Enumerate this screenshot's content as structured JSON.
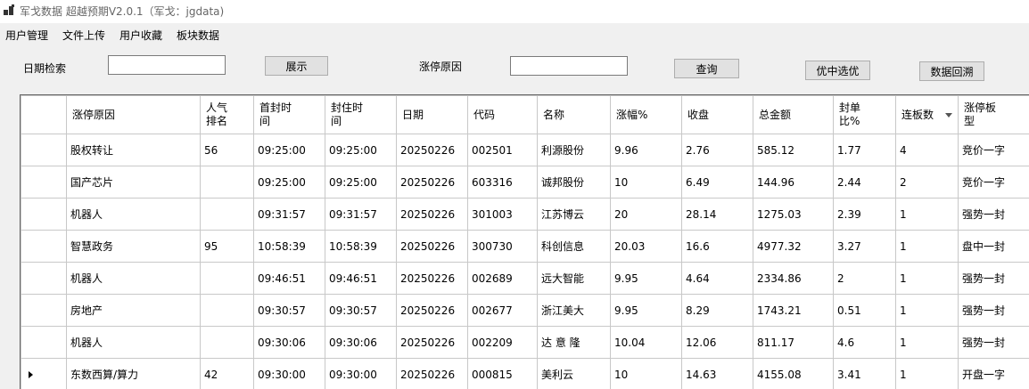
{
  "window": {
    "title": "军戈数据 超越预期V2.0.1（军戈：jgdata)"
  },
  "menu": [
    "用户管理",
    "文件上传",
    "用户收藏",
    "板块数据"
  ],
  "toolbar": {
    "date_label": "日期检索",
    "date_value": "",
    "show_button": "展示",
    "reason_label": "涨停原因",
    "reason_value": "",
    "query_button": "查询",
    "select_button": "优中选优",
    "backtest_button": "数据回溯"
  },
  "grid": {
    "columns": [
      "涨停原因",
      "人气排名",
      "首封时间",
      "封住时间",
      "日期",
      "代码",
      "名称",
      "涨幅%",
      "收盘",
      "总金额",
      "封单比%",
      "连板数",
      "涨停板型"
    ],
    "header_lines": [
      [
        "涨停原因"
      ],
      [
        "人气",
        "排名"
      ],
      [
        "首封时",
        "间"
      ],
      [
        "封住时",
        "间"
      ],
      [
        "日期"
      ],
      [
        "代码"
      ],
      [
        "名称"
      ],
      [
        "涨幅%"
      ],
      [
        "收盘"
      ],
      [
        "总金额"
      ],
      [
        "封单",
        "比%"
      ],
      [
        "连板数"
      ],
      [
        "涨停板",
        "型"
      ]
    ],
    "sorted_column": "连板数",
    "current_row": 7,
    "rows": [
      [
        "股权转让",
        "56",
        "09:25:00",
        "09:25:00",
        "20250226",
        "002501",
        "利源股份",
        "9.96",
        "2.76",
        "585.12",
        "1.77",
        "4",
        "竞价一字"
      ],
      [
        "国产芯片",
        "",
        "09:25:00",
        "09:25:00",
        "20250226",
        "603316",
        "诚邦股份",
        "10",
        "6.49",
        "144.96",
        "2.44",
        "2",
        "竞价一字"
      ],
      [
        "机器人",
        "",
        "09:31:57",
        "09:31:57",
        "20250226",
        "301003",
        "江苏博云",
        "20",
        "28.14",
        "1275.03",
        "2.39",
        "1",
        "强势一封"
      ],
      [
        "智慧政务",
        "95",
        "10:58:39",
        "10:58:39",
        "20250226",
        "300730",
        "科创信息",
        "20.03",
        "16.6",
        "4977.32",
        "3.27",
        "1",
        "盘中一封"
      ],
      [
        "机器人",
        "",
        "09:46:51",
        "09:46:51",
        "20250226",
        "002689",
        "远大智能",
        "9.95",
        "4.64",
        "2334.86",
        "2",
        "1",
        "强势一封"
      ],
      [
        "房地产",
        "",
        "09:30:57",
        "09:30:57",
        "20250226",
        "002677",
        "浙江美大",
        "9.95",
        "8.29",
        "1743.21",
        "0.51",
        "1",
        "强势一封"
      ],
      [
        "机器人",
        "",
        "09:30:06",
        "09:30:06",
        "20250226",
        "002209",
        "达 意 隆",
        "10.04",
        "12.06",
        "811.17",
        "4.6",
        "1",
        "强势一封"
      ],
      [
        "东数西算/算力",
        "42",
        "09:30:00",
        "09:30:00",
        "20250226",
        "000815",
        "美利云",
        "10",
        "14.63",
        "4155.08",
        "3.41",
        "1",
        "开盘一字"
      ]
    ]
  }
}
